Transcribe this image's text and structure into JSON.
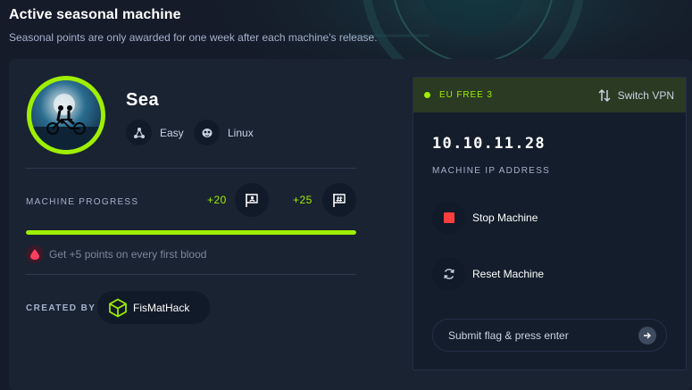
{
  "header": {
    "title": "Active seasonal machine",
    "subtitle": "Seasonal points are only awarded for one week after each machine's release."
  },
  "machine": {
    "name": "Sea",
    "difficulty": "Easy",
    "os": "Linux",
    "progress_label": "MACHINE PROGRESS",
    "user_points": "+20",
    "root_points": "+25",
    "progress_fraction": 1.0,
    "blood_text": "Get +5 points on every first blood",
    "created_by_label": "CREATED BY",
    "creator": "FisMatHack"
  },
  "connection": {
    "vpn_server": "EU FREE 3",
    "switch_vpn_label": "Switch VPN",
    "ip": "10.10.11.28",
    "ip_label": "MACHINE IP ADDRESS",
    "stop_label": "Stop Machine",
    "reset_label": "Reset Machine",
    "flag_placeholder": "Submit flag & press enter"
  },
  "colors": {
    "accent": "#9fef00",
    "background": "#151b29",
    "card": "#1a2332",
    "stop": "#ff3e3e"
  },
  "icons": {
    "difficulty": "network-nodes-icon",
    "os": "penguin-icon",
    "user_flag": "user-flag-icon",
    "root_flag": "root-flag-icon",
    "blood": "blood-drop-icon",
    "creator": "cube-logo-icon",
    "switch_vpn": "swap-arrows-icon",
    "stop": "stop-square-icon",
    "reset": "refresh-icon",
    "submit": "arrow-right-icon"
  }
}
